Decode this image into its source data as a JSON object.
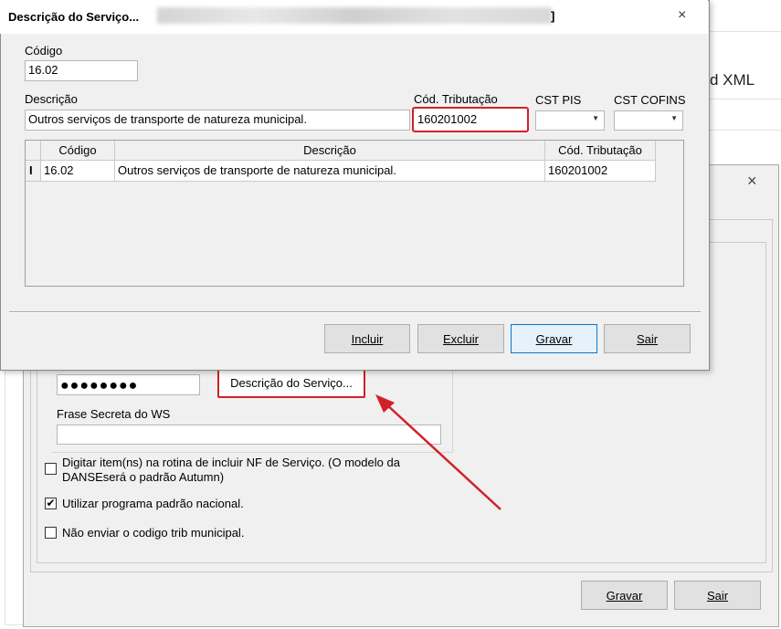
{
  "background_window": {
    "xml_label": "d XML"
  },
  "main_dialog": {
    "title": "Descrição do Serviço...",
    "title_suffix": "]",
    "close_glyph": "×",
    "codigo_label": "Código",
    "codigo_value": "16.02",
    "descricao_label": "Descrição",
    "descricao_value": "Outros serviços de transporte de natureza municipal.",
    "cod_tributacao_label": "Cód. Tributação",
    "cod_tributacao_value": "160201002",
    "cst_pis_label": "CST PIS",
    "cst_cofins_label": "CST COFINS",
    "grid": {
      "columns": [
        "Código",
        "Descrição",
        "Cód. Tributação"
      ],
      "rows": [
        {
          "indicator": "I",
          "codigo": "16.02",
          "descricao": "Outros serviços de transporte de natureza municipal.",
          "cod_tributacao": "160201002"
        }
      ]
    },
    "buttons": {
      "incluir": "Incluir",
      "excluir": "Excluir",
      "gravar": "Gravar",
      "sair": "Sair"
    }
  },
  "second_dialog": {
    "close_glyph": "×",
    "password_mask": "●●●●●●●●",
    "descricao_servico_button": "Descrição do Serviço...",
    "frase_secreta_label": "Frase Secreta do WS",
    "checkboxes": [
      {
        "label_line1": "Digitar item(ns) na rotina de incluir NF de Serviço. (O modelo da",
        "label_line2": "DANSEserá o padrão Autumn)",
        "checked": false
      },
      {
        "label_line1": "Utilizar programa padrão nacional.",
        "label_line2": "",
        "checked": true
      },
      {
        "label_line1": "Não enviar o codigo trib municipal.",
        "label_line2": "",
        "checked": false
      }
    ],
    "check_glyph": "✔",
    "buttons": {
      "gravar": "Gravar",
      "sair": "Sair"
    }
  },
  "annotation": {
    "arrow_color": "#d32027",
    "highlight_color": "#d32027"
  }
}
